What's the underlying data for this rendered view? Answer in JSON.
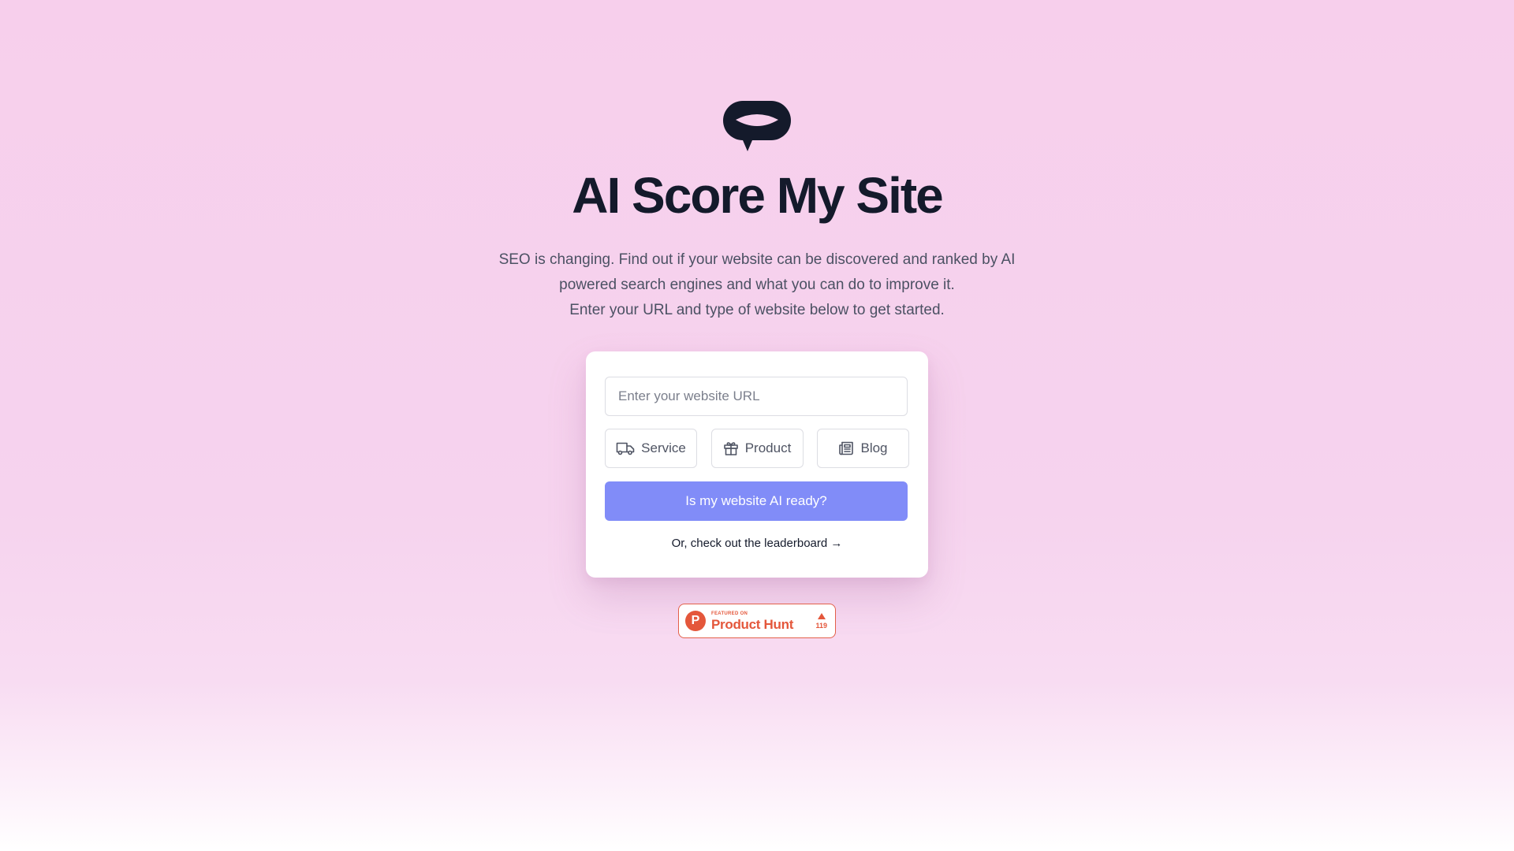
{
  "brand": {
    "logo_icon": "speech-bubble-smile-icon",
    "title": "AI Score My Site"
  },
  "intro": {
    "text": "SEO is changing. Find out if your website can be discovered and ranked by AI powered search engines and what you can do to improve it.",
    "instruction": "Enter your URL and type of website below to get started."
  },
  "form": {
    "url_placeholder": "Enter your website URL",
    "url_value": "",
    "site_types": [
      {
        "label": "Service",
        "icon": "truck-icon"
      },
      {
        "label": "Product",
        "icon": "gift-icon"
      },
      {
        "label": "Blog",
        "icon": "newspaper-icon"
      }
    ],
    "submit_label": "Is my website AI ready?",
    "leaderboard_link": "Or, check out the leaderboard →"
  },
  "product_hunt": {
    "featured_label": "FEATURED ON",
    "name": "Product Hunt",
    "logo_letter": "P",
    "votes": "119"
  },
  "colors": {
    "background": "#f7cfec",
    "title": "#141a2b",
    "accent_button": "#818cf8",
    "product_hunt": "#e4573b"
  }
}
